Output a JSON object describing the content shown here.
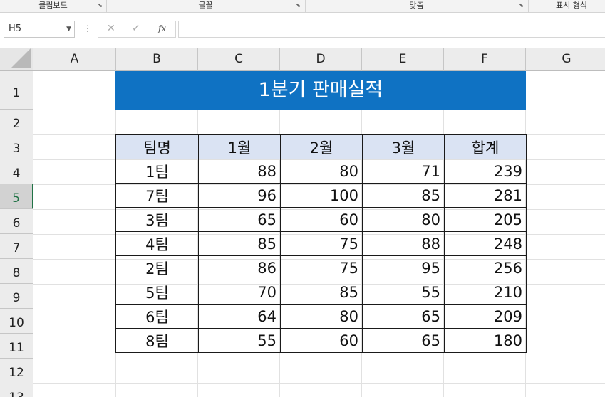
{
  "ribbon": {
    "groups": [
      "클립보드",
      "글꼴",
      "맞춤",
      "표시 형식"
    ]
  },
  "formula_bar": {
    "name_box": "H5",
    "cancel_icon": "✕",
    "enter_icon": "✓",
    "fx_label": "fx",
    "formula": ""
  },
  "sheet": {
    "columns": [
      "A",
      "B",
      "C",
      "D",
      "E",
      "F",
      "G"
    ],
    "rows": [
      "1",
      "2",
      "3",
      "4",
      "5",
      "6",
      "7",
      "8",
      "9",
      "10",
      "11",
      "12",
      "13"
    ],
    "active_row": "5",
    "title": "1분기 판매실적",
    "title_bg": "#0f72c3",
    "header_bg": "#dae3f3",
    "headers": [
      "팀명",
      "1월",
      "2월",
      "3월",
      "합계"
    ],
    "data": [
      [
        "1팀",
        "88",
        "80",
        "71",
        "239"
      ],
      [
        "7팀",
        "96",
        "100",
        "85",
        "281"
      ],
      [
        "3팀",
        "65",
        "60",
        "80",
        "205"
      ],
      [
        "4팀",
        "85",
        "75",
        "88",
        "248"
      ],
      [
        "2팀",
        "86",
        "75",
        "95",
        "256"
      ],
      [
        "5팀",
        "70",
        "85",
        "55",
        "210"
      ],
      [
        "6팀",
        "64",
        "80",
        "65",
        "209"
      ],
      [
        "8팀",
        "55",
        "60",
        "65",
        "180"
      ]
    ]
  }
}
